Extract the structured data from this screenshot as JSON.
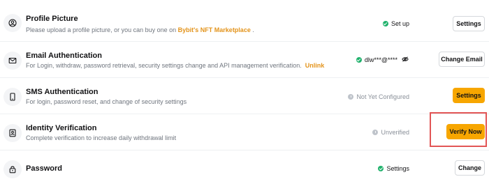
{
  "rows": [
    {
      "icon": "user-circle-icon",
      "title": "Profile Picture",
      "description_prefix": "Please upload a profile picture, or you can buy one on ",
      "description_link": "Bybit's NFT Marketplace",
      "description_suffix": " .",
      "status": "Set up",
      "button": "Settings"
    },
    {
      "icon": "envelope-icon",
      "title": "Email Authentication",
      "description_prefix": "For Login, withdraw, password retrieval, security settings change and API management verification.",
      "description_link": "Unlink",
      "status": "dlw***@****",
      "status_icon": "eye-slash-icon",
      "button": "Change Email"
    },
    {
      "icon": "phone-icon",
      "title": "SMS Authentication",
      "description": "For login, password reset, and change of security settings",
      "status": "Not Yet Configured",
      "button": "Settings"
    },
    {
      "icon": "id-card-icon",
      "title": "Identity Verification",
      "description": "Complete verification to increase daily withdrawal limit",
      "status": "Unverified",
      "button": "Verify Now"
    },
    {
      "icon": "lock-icon",
      "title": "Password",
      "status": "Settings",
      "button": "Change"
    }
  ],
  "colors": {
    "accent": "#f7a600",
    "link": "#e3931a",
    "success": "#20b26c",
    "muted": "#bfc4cb",
    "highlight": "#e25555"
  }
}
